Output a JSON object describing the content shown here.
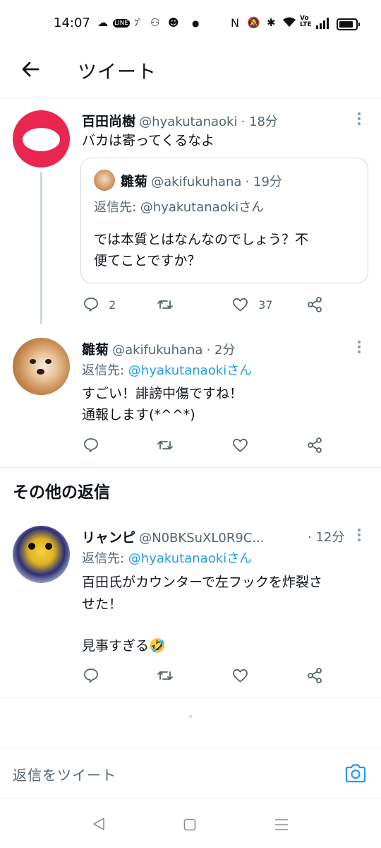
{
  "status_bar": {
    "time": "14:07",
    "volte_label": "Vo\nLTE"
  },
  "header": {
    "title": "ツイート"
  },
  "main_tweet": {
    "display_name": "百田尚樹",
    "handle": "@hyakutanaoki",
    "time": "· 18分",
    "text": "バカは寄ってくるなよ",
    "quote": {
      "display_name": "雛菊",
      "handle": "@akifukuhana",
      "time": "· 19分",
      "reply_to_prefix": "返信先: ",
      "reply_to_handle": "@hyakutanaokiさん",
      "text_line1": "では本質とはなんなのでしょう？不",
      "text_line2": "便てことですか？"
    },
    "reply_count": "2",
    "like_count": "37"
  },
  "reply_tweet": {
    "display_name": "雛菊",
    "handle": "@akifukuhana",
    "time": "· 2分",
    "reply_to_prefix": "返信先: ",
    "reply_to_handle": "@hyakutanaokiさん",
    "text_line1": "すごい！誹謗中傷ですね！",
    "text_line2": "通報します(*^^*)"
  },
  "other_replies": {
    "title": "その他の返信"
  },
  "other_tweet": {
    "display_name": "リャンピ",
    "handle": "@N0BKSuXL0R9C...",
    "time": "· 12分",
    "reply_to_prefix": "返信先: ",
    "reply_to_handle": "@hyakutanaokiさん",
    "text_line1": "百田氏がカウンターで左フックを炸裂さ",
    "text_line2": "せた！",
    "text_line3": "見事すぎる",
    "emoji": "🤣"
  },
  "reply_bar": {
    "placeholder": "返信をツイート"
  },
  "colors": {
    "accent": "#1d9bf0",
    "secondary_text": "#536471",
    "avatar_ring": "#e8264f"
  }
}
